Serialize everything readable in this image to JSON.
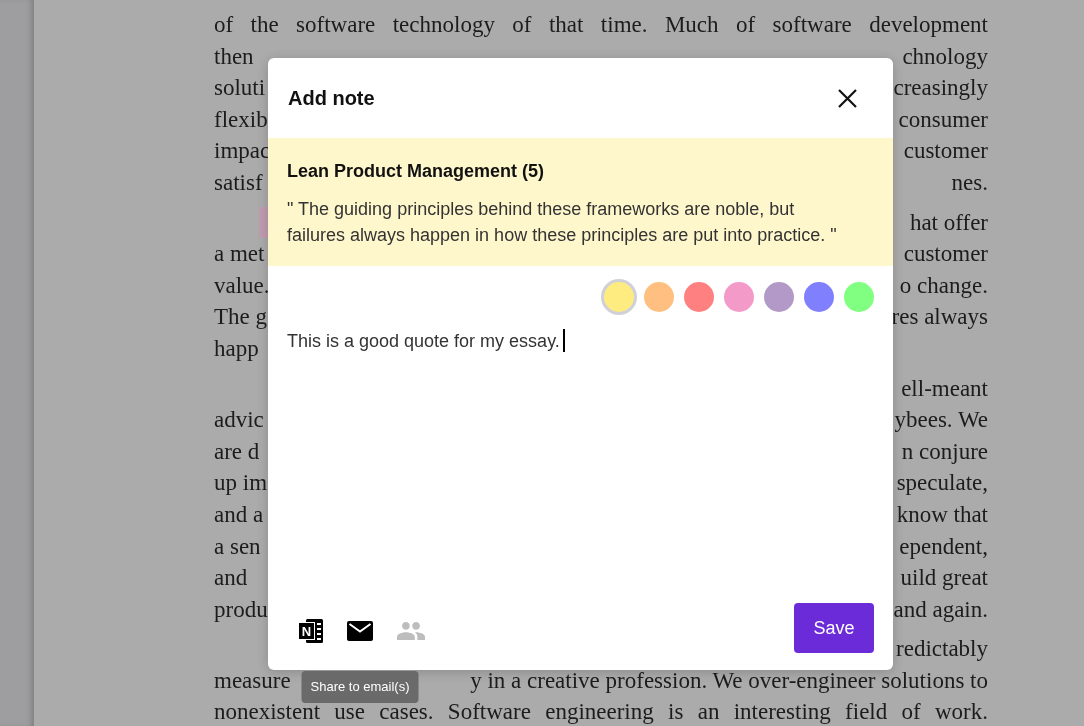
{
  "document": {
    "paragraphs": [
      {
        "lines": [
          {
            "text": "of the software technology of that time. Much of software development",
            "highlight": false
          },
          {
            "left": "then",
            "right": "chnology",
            "highlight": false
          },
          {
            "left": "soluti",
            "right": "creasingly",
            "highlight": false
          },
          {
            "left": "flexib",
            "right": "consumer",
            "highlight": false
          },
          {
            "left": "impac",
            "right": "customer",
            "highlight": false
          },
          {
            "left": "satisf",
            "right": "nes.",
            "highlight": false
          }
        ]
      },
      {
        "lines": [
          {
            "right": "hat offer",
            "highlight": true
          },
          {
            "left": "a met",
            "right": "customer",
            "highlight": false
          },
          {
            "left": "value.",
            "right": "o change.",
            "highlight": false
          },
          {
            "left": "The g",
            "right": "res always",
            "highlight": false
          },
          {
            "left": "happ",
            "highlight": false
          }
        ]
      },
      {
        "lines": [
          {
            "right": "ell-meant",
            "highlight": false
          },
          {
            "left": "advic",
            "right": "ybees. We",
            "highlight": false
          },
          {
            "left": "are d",
            "right": "n conjure",
            "highlight": false
          },
          {
            "left": "up im",
            "right": "speculate,",
            "highlight": false
          },
          {
            "left": "and a",
            "right": "know that",
            "highlight": false
          },
          {
            "left": "a sen",
            "right": "ependent,",
            "highlight": false
          },
          {
            "left": "and",
            "right": "uild great",
            "highlight": false
          },
          {
            "left": "produ",
            "right": "and again.",
            "highlight": false
          }
        ]
      },
      {
        "lines": [
          {
            "right": "redictably",
            "highlight": false
          },
          {
            "left": "measure",
            "right": "y in a creative profession. We over-engineer solutions to",
            "highlight": false
          },
          {
            "text": "nonexistent use cases. Software engineering is an interesting field of work.",
            "highlight": false
          }
        ]
      }
    ]
  },
  "dialog": {
    "title": "Add note",
    "source": "Lean Product Management (5)",
    "quote": "\" The guiding principles behind these frameworks are noble, but failures always happen in how these principles are put into practice. \"",
    "colors": [
      {
        "color": "#ffec80",
        "selected": true
      },
      {
        "color": "#ffbf80",
        "selected": false
      },
      {
        "color": "#ff8080",
        "selected": false
      },
      {
        "color": "#f49ac8",
        "selected": false
      },
      {
        "color": "#b399c8",
        "selected": false
      },
      {
        "color": "#8080ff",
        "selected": false
      },
      {
        "color": "#80ff80",
        "selected": false
      }
    ],
    "note": {
      "value": "This is a good quote for my essay.",
      "focused": true
    },
    "share_buttons": [
      {
        "kind": "notebook",
        "glyph": "N",
        "disabled": false
      },
      {
        "kind": "email",
        "disabled": false,
        "tooltip": "Share to email(s)"
      },
      {
        "kind": "people",
        "disabled": true
      }
    ],
    "save_button": "Save"
  }
}
